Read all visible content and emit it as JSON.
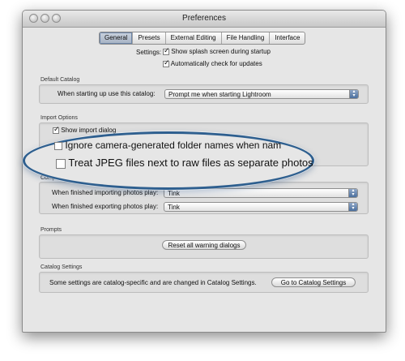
{
  "window": {
    "title": "Preferences"
  },
  "tabs": [
    {
      "label": "General"
    },
    {
      "label": "Presets"
    },
    {
      "label": "External Editing"
    },
    {
      "label": "File Handling"
    },
    {
      "label": "Interface"
    }
  ],
  "settings": {
    "label": "Settings:",
    "splash": "Show splash screen during startup",
    "updates": "Automatically check for updates"
  },
  "default_catalog": {
    "group_label": "Default Catalog",
    "label": "When starting up use this catalog:",
    "value": "Prompt me when starting Lightroom"
  },
  "import_options": {
    "group_label": "Import Options",
    "show_import": "Show import dialog",
    "ignore_folders": "Ignore camera-generated folder names when nam",
    "treat_jpeg": "Treat JPEG files next to raw files as separate photos"
  },
  "completion_sounds": {
    "group_label": "Compl",
    "importing_label": "When finished importing photos play:",
    "importing_value": "Tink",
    "exporting_label": "When finished exporting photos play:",
    "exporting_value": "Tink"
  },
  "prompts": {
    "group_label": "Prompts",
    "reset_button": "Reset all warning dialogs"
  },
  "catalog_settings": {
    "group_label": "Catalog Settings",
    "text": "Some settings are catalog-specific and are changed in Catalog Settings.",
    "button": "Go to Catalog Settings"
  }
}
